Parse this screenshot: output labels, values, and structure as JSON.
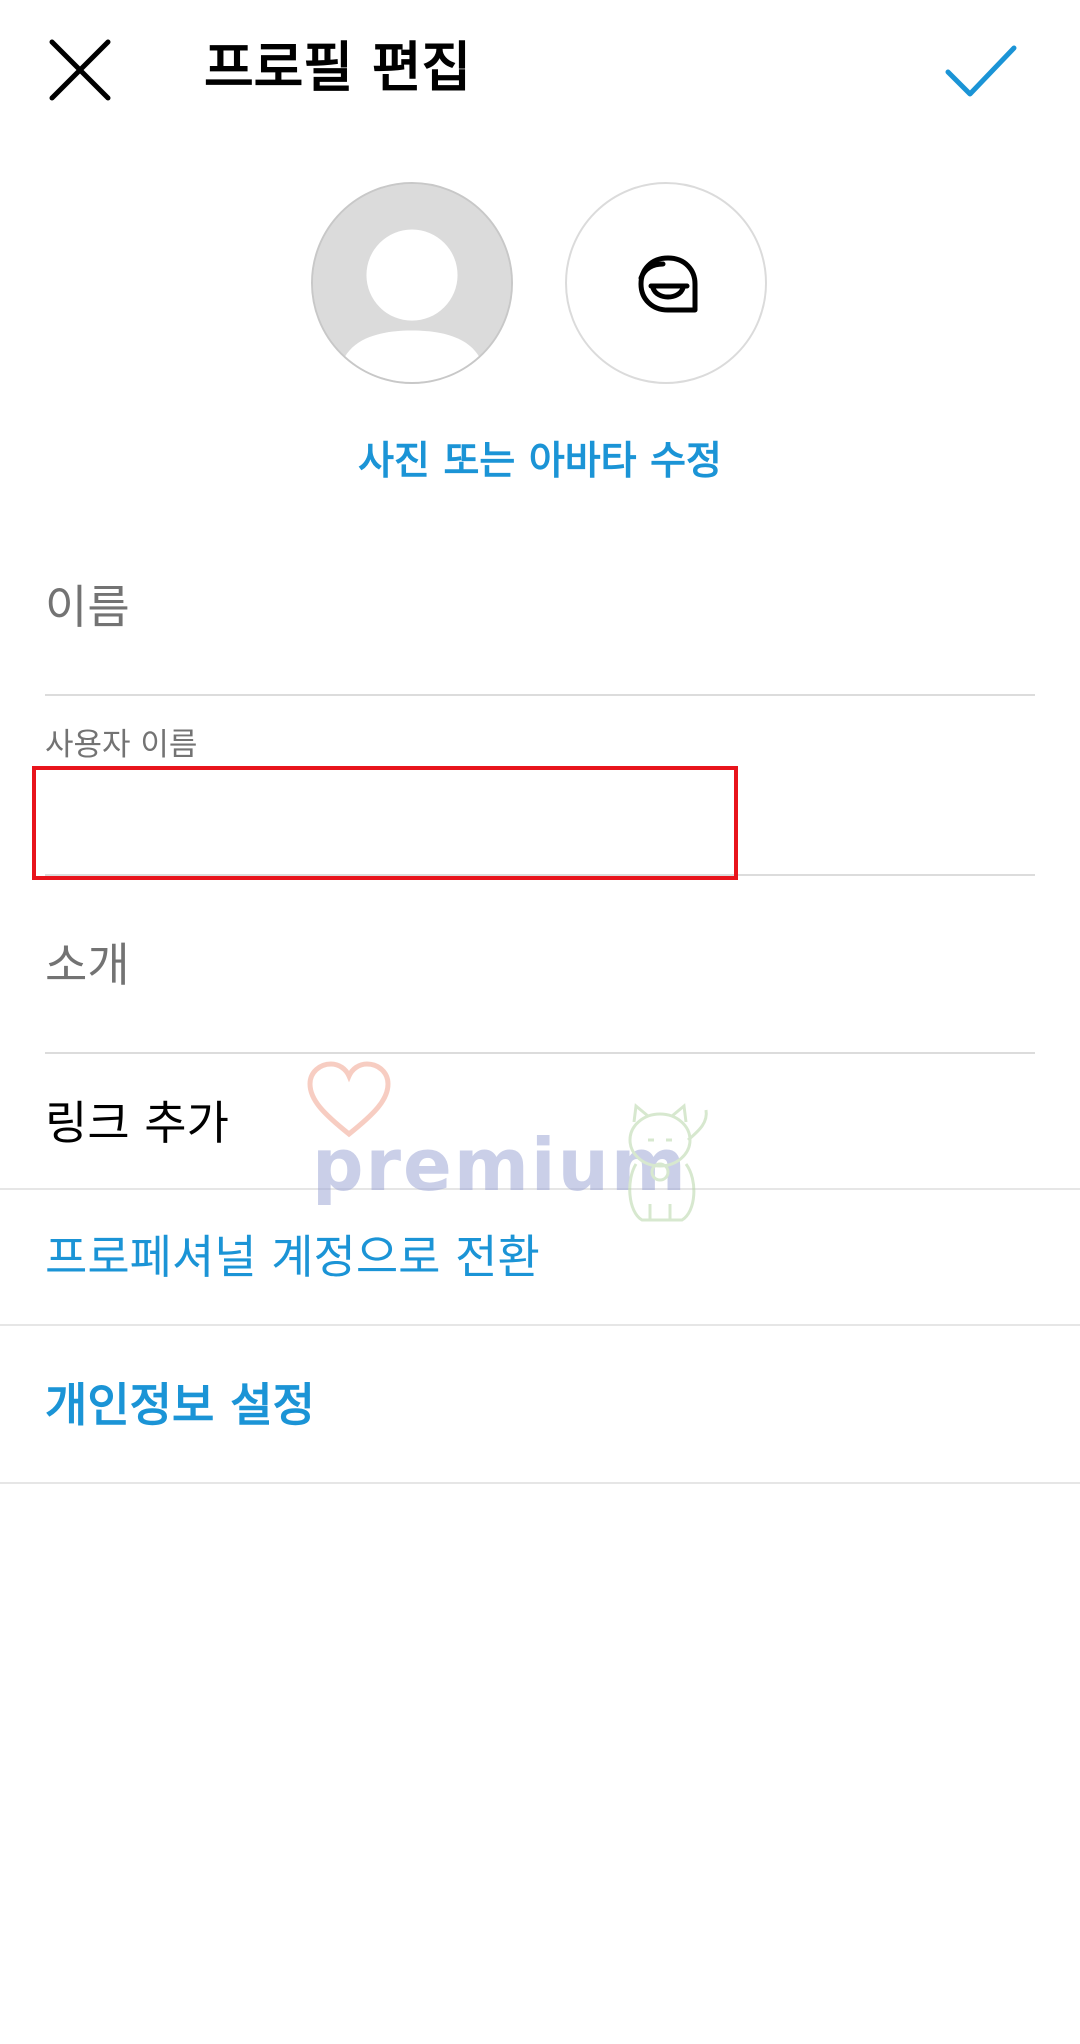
{
  "header": {
    "close_icon": "close-icon",
    "title": "프로필 편집",
    "done_icon": "check-icon",
    "accent_color": "#1b94d6"
  },
  "avatars": {
    "photo_icon": "default-avatar-icon",
    "sticker_icon": "avatar-sticker-icon",
    "edit_label": "사진 또는 아바타 수정"
  },
  "form": {
    "name": {
      "placeholder": "이름"
    },
    "username": {
      "label": "사용자 이름",
      "value": ""
    },
    "bio": {
      "placeholder": "소개"
    },
    "add_link": "링크 추가"
  },
  "menu": {
    "switch_professional": "프로페셔널 계정으로 전환",
    "privacy_settings": "개인정보 설정"
  },
  "watermark": {
    "text": "premium",
    "heart_icon": "heart-outline-icon",
    "cat_icon": "lucky-cat-icon"
  },
  "annotation": {
    "highlight_color": "#e8141c"
  }
}
